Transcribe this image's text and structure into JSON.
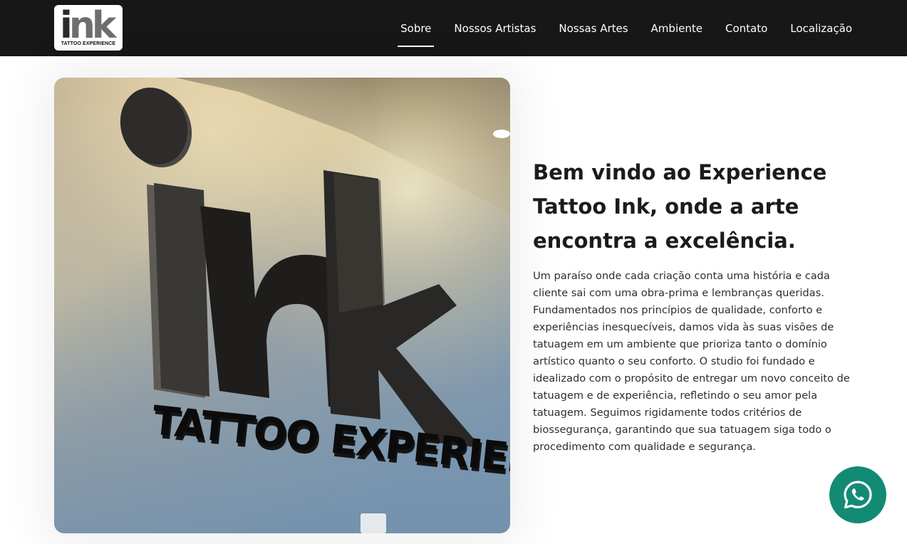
{
  "brand": {
    "logo_main": "ink",
    "logo_sub": "TATTOO EXPERIENCE"
  },
  "nav": {
    "items": [
      {
        "label": "Sobre",
        "active": true
      },
      {
        "label": "Nossos Artistas",
        "active": false
      },
      {
        "label": "Nossas Artes",
        "active": false
      },
      {
        "label": "Ambiente",
        "active": false
      },
      {
        "label": "Contato",
        "active": false
      },
      {
        "label": "Localização",
        "active": false
      }
    ]
  },
  "hero_image": {
    "sign_main": "ink",
    "sign_sub": "TATTOO EXPERIENCE"
  },
  "about": {
    "heading": "Bem vindo ao Experience Tattoo Ink, onde a arte encontra a excelência.",
    "body": "Um paraíso onde cada criação conta uma história e cada cliente sai com uma obra-prima e lembranças queridas. Fundamentados nos princípios de qualidade, conforto e experiências inesquecíveis, damos vida às suas visões de tatuagem em um ambiente que prioriza tanto o domínio artístico quanto o seu conforto. O studio foi fundado e idealizado com o propósito de entregar um novo conceito de tatuagem e de experiência, refletindo o seu amor pela tatuagem. Seguimos rigidamente todos critérios de biossegurança, garantindo que sua tatuagem siga todo o procedimento com qualidade e segurança."
  },
  "whatsapp": {
    "icon": "whatsapp-icon",
    "color": "#138a74"
  },
  "colors": {
    "navbar_bg": "#171717",
    "text": "#1b1b1b"
  }
}
